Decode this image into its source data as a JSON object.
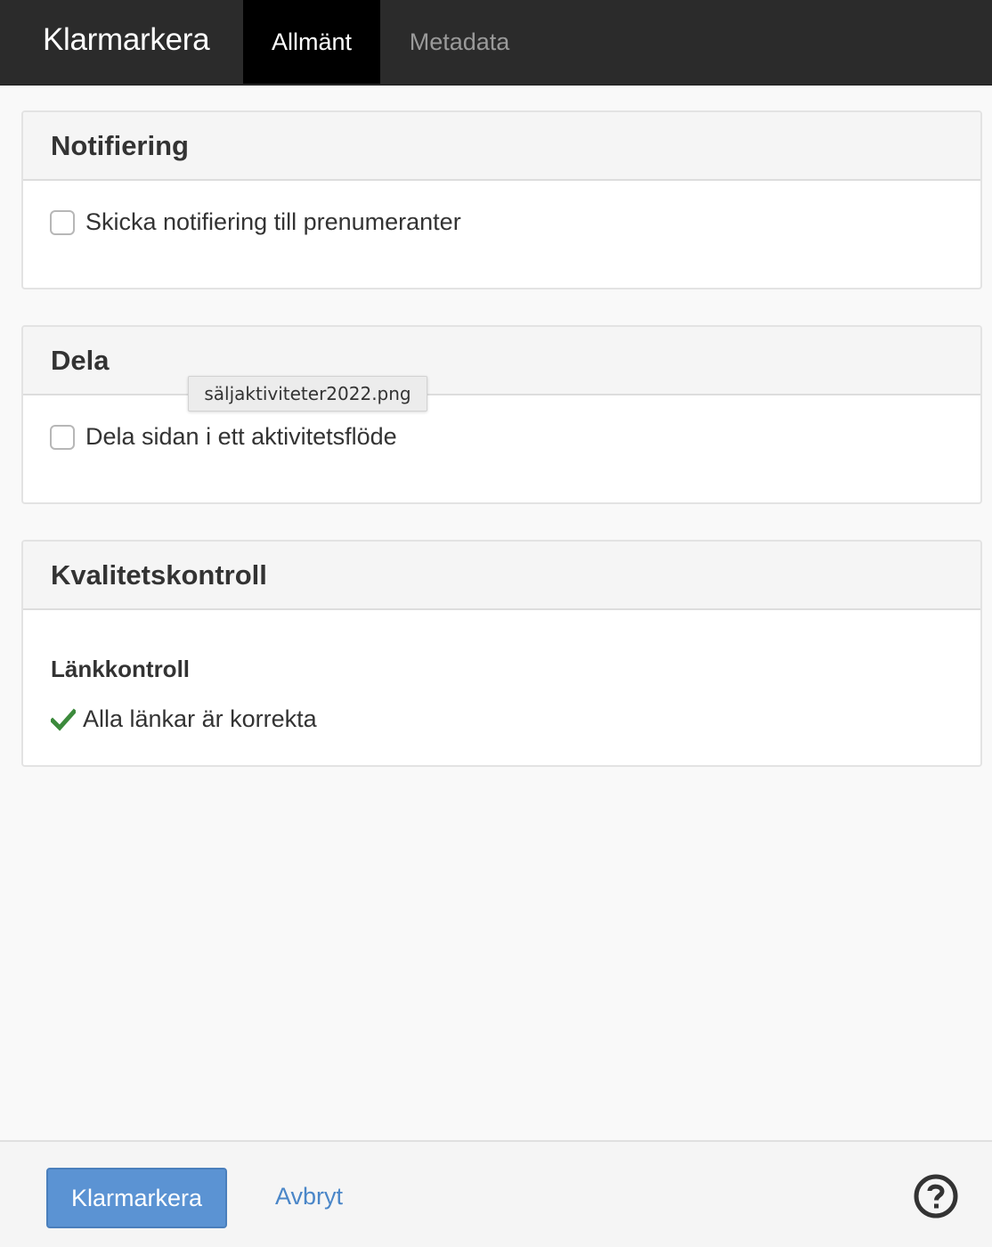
{
  "header": {
    "title": "Klarmarkera",
    "tabs": [
      {
        "label": "Allmänt",
        "active": true
      },
      {
        "label": "Metadata",
        "active": false
      }
    ]
  },
  "panels": {
    "notification": {
      "title": "Notifiering",
      "checkbox_label": "Skicka notifiering till prenumeranter",
      "checked": false
    },
    "share": {
      "title": "Dela",
      "checkbox_label": "Dela sidan i ett aktivitetsflöde",
      "checked": false
    },
    "quality": {
      "title": "Kvalitetskontroll",
      "subheading": "Länkkontroll",
      "status_text": "Alla länkar är korrekta",
      "status_icon": "checkmark-icon"
    }
  },
  "tooltip": {
    "text": "säljaktiviteter2022.png"
  },
  "footer": {
    "primary_label": "Klarmarkera",
    "cancel_label": "Avbryt",
    "help_icon": "help-icon"
  },
  "colors": {
    "topbar": "#2b2b2b",
    "active_tab": "#000000",
    "primary_button": "#5b93d3",
    "link": "#4a86c8",
    "success": "#3c8a3c"
  }
}
